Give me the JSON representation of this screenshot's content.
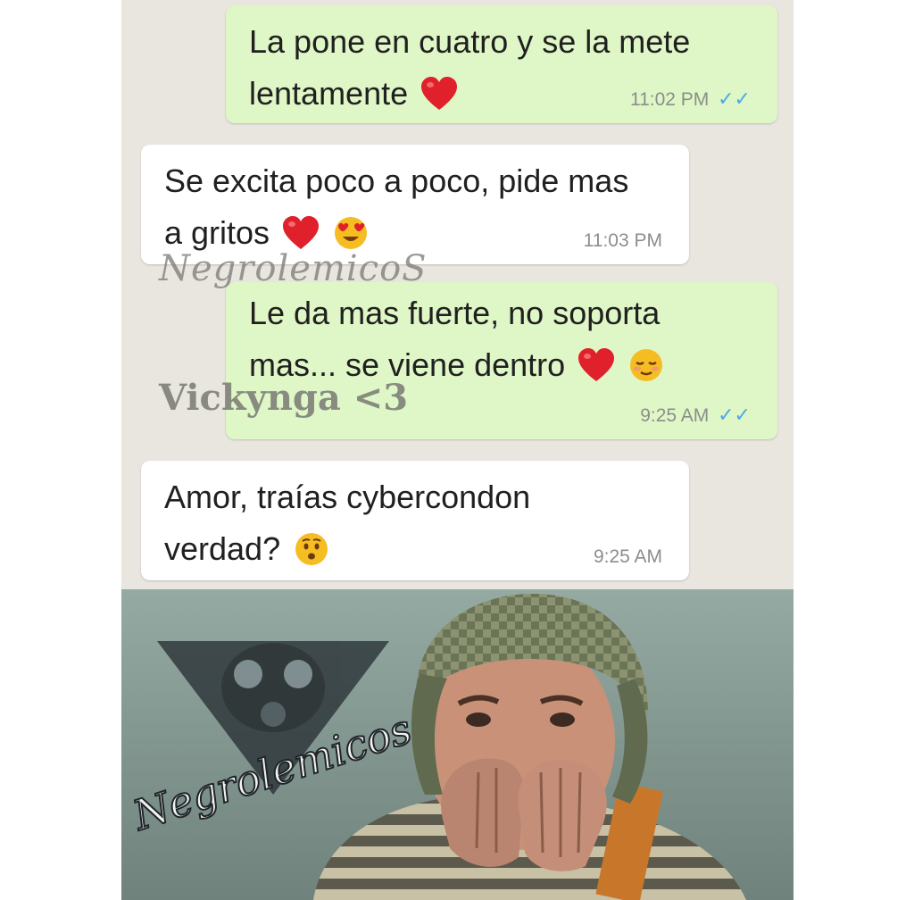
{
  "messages": [
    {
      "direction": "outgoing",
      "line1": "La pone en cuatro y se la mete",
      "line2": "lentamente",
      "emojis": [
        "red-heart"
      ],
      "time": "11:02 PM",
      "read": true
    },
    {
      "direction": "incoming",
      "line1": "Se excita poco a poco, pide mas",
      "line2": "a gritos",
      "emojis": [
        "red-heart",
        "heart-eyes-face"
      ],
      "time": "11:03 PM",
      "read": false
    },
    {
      "direction": "outgoing",
      "line1": "Le da mas fuerte, no soporta",
      "line2": "mas... se viene dentro",
      "emojis": [
        "red-heart",
        "relieved-face"
      ],
      "time": "9:25 AM",
      "read": true
    },
    {
      "direction": "incoming",
      "line1": "Amor, traías cybercondon",
      "line2": "verdad?",
      "emojis": [
        "hushed-face"
      ],
      "time": "9:25 AM",
      "read": false
    }
  ],
  "read_ticks": "✓✓",
  "watermarks": {
    "top": "NegrolemicoS",
    "middle": "Vickynga <3",
    "logo": "Negrolemicos"
  },
  "colors": {
    "outgoing_bubble": "#dff7c6",
    "incoming_bubble": "#ffffff",
    "chat_background": "#e9e6df",
    "tick_blue": "#4fa6e8",
    "heart_red": "#e0202a"
  },
  "reaction_image": {
    "subject": "boy with checkered cap covering mouth with both hands"
  }
}
